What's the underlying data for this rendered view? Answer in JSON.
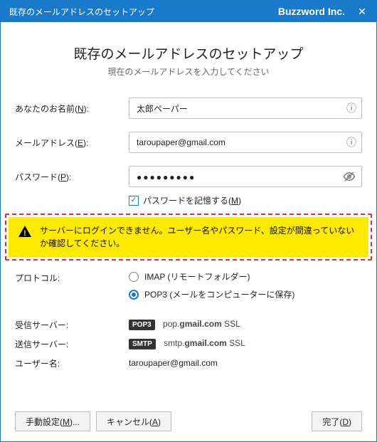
{
  "window": {
    "title_left": "既存のメールアドレスのセットアップ",
    "title_right": "Buzzword Inc.",
    "close_glyph": "✕"
  },
  "header": {
    "title": "既存のメールアドレスのセットアップ",
    "subtitle": "現在のメールアドレスを入力してください"
  },
  "form": {
    "name_label_pre": "あなたのお名前(",
    "name_label_key": "N",
    "name_label_post": "):",
    "name_value": "太郎ペーパー",
    "email_label_pre": "メールアドレス(",
    "email_label_key": "E",
    "email_label_post": "):",
    "email_value": "taroupaper@gmail.com",
    "password_label_pre": "パスワード(",
    "password_label_key": "P",
    "password_label_post": "):",
    "password_mask": "●●●●●●●●●",
    "remember_label_pre": "パスワードを記憶する(",
    "remember_label_key": "M",
    "remember_label_post": ")",
    "remember_checked": true
  },
  "alert": {
    "text": "サーバーにログインできません。ユーザー名やパスワード、設定が間違っていないか確認してください。"
  },
  "protocol": {
    "label": "プロトコル:",
    "imap_label": "IMAP (リモートフォルダー)",
    "pop3_label": "POP3 (メールをコンピューターに保存)",
    "selected": "pop3"
  },
  "servers": {
    "incoming_label": "受信サーバー:",
    "incoming_tag": "POP3",
    "incoming_pre": "pop.",
    "incoming_bold": "gmail.com",
    "incoming_post": " SSL",
    "outgoing_label": "送信サーバー:",
    "outgoing_tag": "SMTP",
    "outgoing_pre": "smtp.",
    "outgoing_bold": "gmail.com",
    "outgoing_post": " SSL",
    "username_label": "ユーザー名:",
    "username_value": "taroupaper@gmail.com"
  },
  "footer": {
    "manual_pre": "手動設定(",
    "manual_key": "M",
    "manual_post": ")...",
    "cancel_pre": "キャンセル(",
    "cancel_key": "A",
    "cancel_post": ")",
    "done_pre": "完了(",
    "done_key": "D",
    "done_post": ")"
  }
}
